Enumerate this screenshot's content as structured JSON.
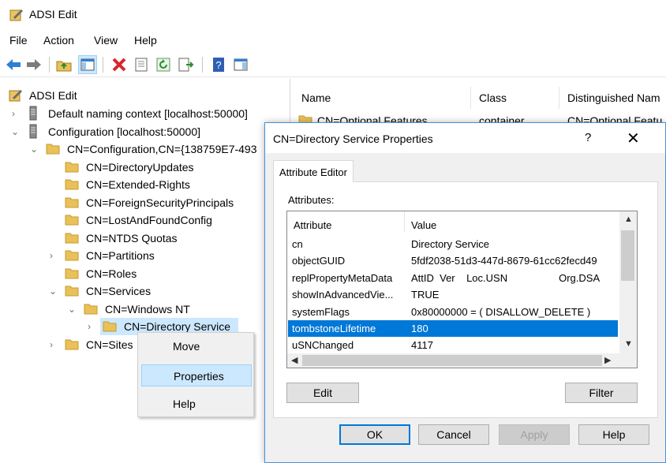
{
  "window": {
    "title": "ADSI Edit"
  },
  "menu": [
    {
      "label": "File"
    },
    {
      "label": "Action"
    },
    {
      "label": "View"
    },
    {
      "label": "Help"
    }
  ],
  "tree": {
    "root": "ADSI Edit",
    "items": [
      {
        "label": "Default naming context [localhost:50000]"
      },
      {
        "label": "Configuration [localhost:50000]"
      },
      {
        "label": "CN=Configuration,CN={138759E7-493"
      },
      {
        "label": "CN=DirectoryUpdates"
      },
      {
        "label": "CN=Extended-Rights"
      },
      {
        "label": "CN=ForeignSecurityPrincipals"
      },
      {
        "label": "CN=LostAndFoundConfig"
      },
      {
        "label": "CN=NTDS Quotas"
      },
      {
        "label": "CN=Partitions"
      },
      {
        "label": "CN=Roles"
      },
      {
        "label": "CN=Services"
      },
      {
        "label": "CN=Windows NT"
      },
      {
        "label": "CN=Directory Service"
      },
      {
        "label": "CN=Sites"
      }
    ]
  },
  "list": {
    "headers": [
      "Name",
      "Class",
      "Distinguished Nam"
    ],
    "rows": [
      {
        "name": "CN=Optional Features",
        "class": "container",
        "dn": "CN=Optional Featu"
      }
    ],
    "fragments": [
      "es",
      "io"
    ]
  },
  "context_menu": {
    "items": [
      "Move",
      "Properties",
      "Help"
    ],
    "highlighted": "Properties"
  },
  "dialog": {
    "title": "CN=Directory Service Properties",
    "help_glyph": "?",
    "close_glyph": "✕",
    "tab": "Attribute Editor",
    "attributes_label": "Attributes:",
    "columns": [
      "Attribute",
      "Value"
    ],
    "rows": [
      {
        "attr": "cn",
        "value": "Directory Service"
      },
      {
        "attr": "objectGUID",
        "value": "5fdf2038-51d3-447d-8679-61cc62fecd49"
      },
      {
        "attr": "replPropertyMetaData",
        "value": "AttID  Ver    Loc.USN                  Org.DSA"
      },
      {
        "attr": "showInAdvancedVie...",
        "value": "TRUE"
      },
      {
        "attr": "systemFlags",
        "value": "0x80000000 = ( DISALLOW_DELETE )"
      },
      {
        "attr": "tombstoneLifetime",
        "value": "180"
      },
      {
        "attr": "uSNChanged",
        "value": "4117"
      }
    ],
    "selected_attr": "tombstoneLifetime",
    "edit_label": "Edit",
    "filter_label": "Filter",
    "ok_label": "OK",
    "cancel_label": "Cancel",
    "apply_label": "Apply",
    "help_label": "Help"
  },
  "colors": {
    "selection": "#0078d7",
    "menu_highlight": "#cce8ff",
    "tree_selected": "#cce8ff",
    "folder": "#e8c15a"
  }
}
